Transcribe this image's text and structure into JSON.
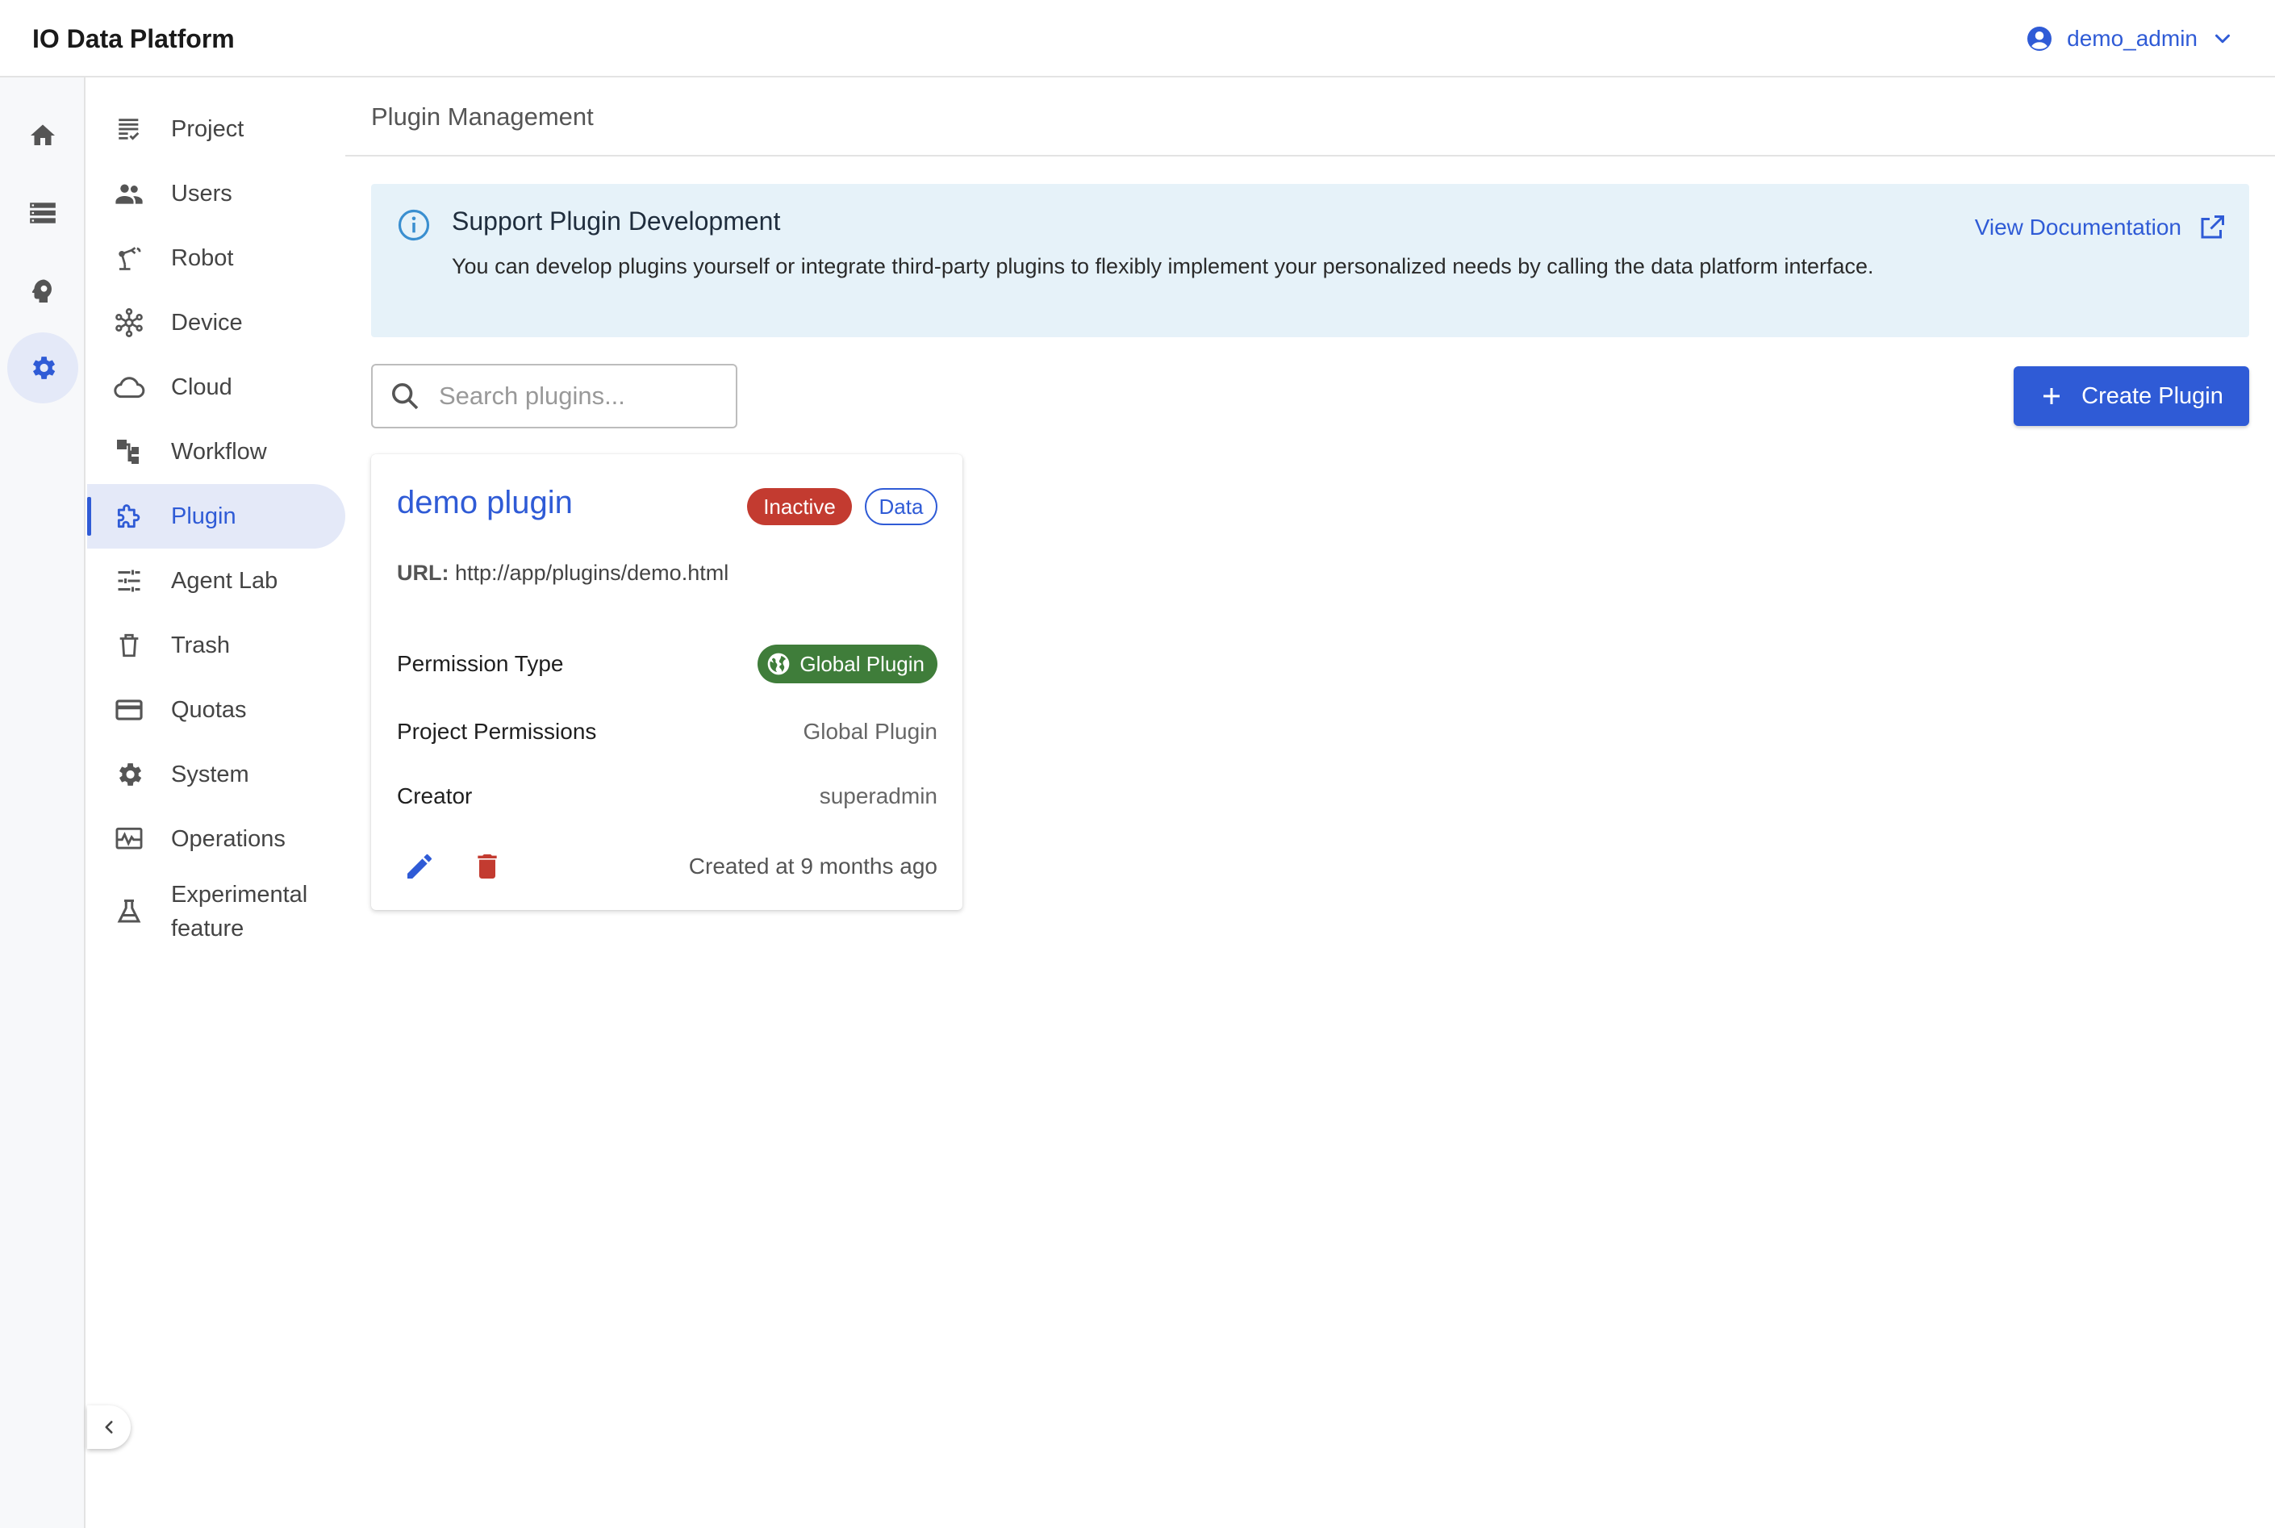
{
  "app": {
    "title": "IO Data Platform"
  },
  "user": {
    "name": "demo_admin"
  },
  "rail": [
    "home-icon",
    "storage-icon",
    "brain-icon",
    "gear-icon"
  ],
  "nav": {
    "items": [
      {
        "label": "Project",
        "icon": "checklist-icon"
      },
      {
        "label": "Users",
        "icon": "users-icon"
      },
      {
        "label": "Robot",
        "icon": "robot-arm-icon"
      },
      {
        "label": "Device",
        "icon": "hub-icon"
      },
      {
        "label": "Cloud",
        "icon": "cloud-icon"
      },
      {
        "label": "Workflow",
        "icon": "workflow-icon"
      },
      {
        "label": "Plugin",
        "icon": "puzzle-icon",
        "active": true
      },
      {
        "label": "Agent Lab",
        "icon": "sliders-icon"
      },
      {
        "label": "Trash",
        "icon": "trash-icon"
      },
      {
        "label": "Quotas",
        "icon": "card-icon"
      },
      {
        "label": "System",
        "icon": "gear-icon"
      },
      {
        "label": "Operations",
        "icon": "monitor-icon"
      },
      {
        "label": "Experimental feature",
        "icon": "flask-icon"
      }
    ]
  },
  "page": {
    "title": "Plugin Management"
  },
  "banner": {
    "title": "Support Plugin Development",
    "text": "You can develop plugins yourself or integrate third-party plugins to flexibly implement your personalized needs by calling the data platform interface.",
    "link_label": "View Documentation"
  },
  "search": {
    "placeholder": "Search plugins...",
    "value": ""
  },
  "create_button": {
    "label": "Create Plugin"
  },
  "colors": {
    "accent": "#2f5bd6",
    "inactive": "#c33b30",
    "global": "#3f7d3a",
    "banner_bg": "#e6f2f9"
  },
  "plugins": [
    {
      "name": "demo plugin",
      "status": "Inactive",
      "type": "Data",
      "url_label": "URL:",
      "url": "http://app/plugins/demo.html",
      "permission_type_label": "Permission Type",
      "permission_type": "Global Plugin",
      "project_permissions_label": "Project Permissions",
      "project_permissions": "Global Plugin",
      "creator_label": "Creator",
      "creator": "superadmin",
      "created": "Created at 9 months ago"
    }
  ]
}
